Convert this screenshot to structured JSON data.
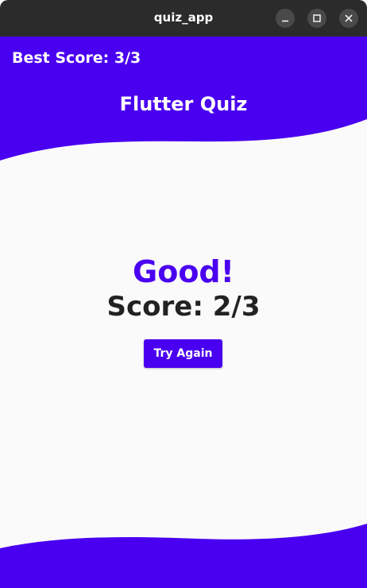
{
  "window": {
    "title": "quiz_app",
    "controls": {
      "minimize": "minimize-icon",
      "maximize": "maximize-icon",
      "close": "close-icon"
    }
  },
  "header": {
    "best_score": "Best Score: 3/3",
    "title": "Flutter Quiz"
  },
  "result": {
    "verdict": "Good!",
    "score": "Score: 2/3",
    "try_again_label": "Try Again"
  },
  "colors": {
    "accent": "#4a00f0",
    "background": "#fafafa",
    "titlebar": "#2b2b2b",
    "score_text": "#222222"
  }
}
